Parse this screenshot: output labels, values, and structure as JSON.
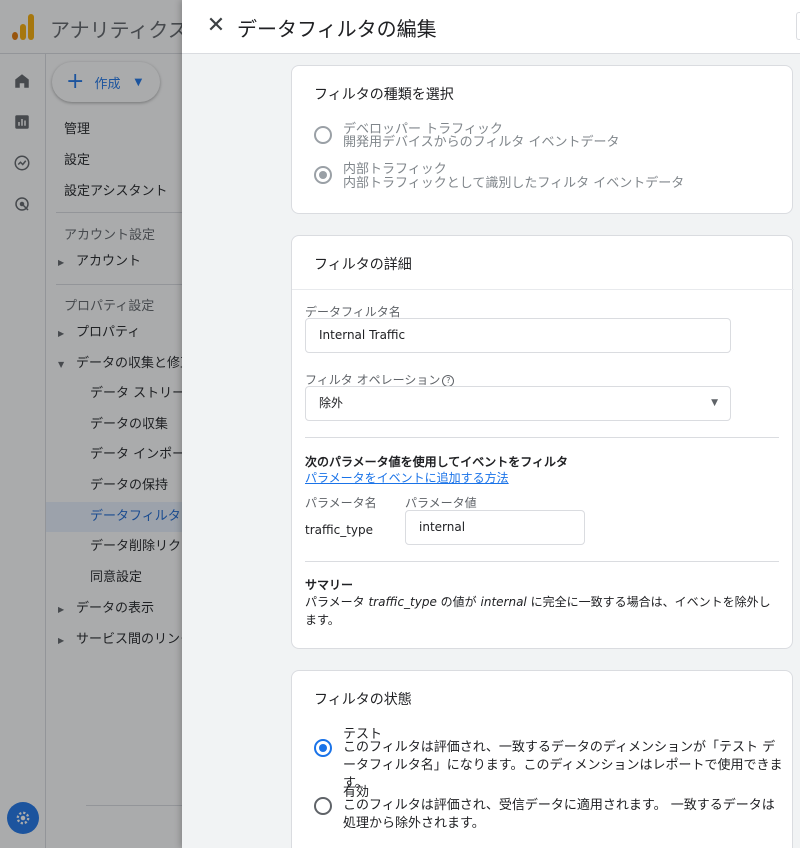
{
  "app": {
    "title": "アナリティクス",
    "create_label": "作成"
  },
  "nav": {
    "items": [
      {
        "label": "管理"
      },
      {
        "label": "設定"
      },
      {
        "label": "設定アシスタント"
      }
    ],
    "account_section": "アカウント設定",
    "account_item": "アカウント",
    "property_section": "プロパティ設定",
    "property_item": "プロパティ",
    "data_collection": "データの収集と修正",
    "sub_items": [
      {
        "label": "データ ストリーム"
      },
      {
        "label": "データの収集"
      },
      {
        "label": "データ インポート"
      },
      {
        "label": "データの保持"
      },
      {
        "label": "データフィルタ"
      },
      {
        "label": "データ削除リクエスト"
      },
      {
        "label": "同意設定"
      }
    ],
    "data_display": "データの表示",
    "service_links": "サービス間のリンク"
  },
  "panel": {
    "title": "データフィルタの編集",
    "type_card": {
      "title": "フィルタの種類を選択",
      "options": [
        {
          "label": "デベロッパー トラフィック",
          "desc": "開発用デバイスからのフィルタ イベントデータ",
          "checked": false
        },
        {
          "label": "内部トラフィック",
          "desc": "内部トラフィックとして識別したフィルタ イベントデータ",
          "checked": true
        }
      ]
    },
    "details_card": {
      "title": "フィルタの詳細",
      "name_label": "データフィルタ名",
      "name_value": "Internal Traffic",
      "operation_label": "フィルタ オペレーション",
      "operation_value": "除外",
      "param_heading": "次のパラメータ値を使用してイベントをフィルタ",
      "param_link": "パラメータをイベントに追加する方法",
      "param_name_header": "パラメータ名",
      "param_value_header": "パラメータ値",
      "param_name": "traffic_type",
      "param_value": "internal",
      "summary_title": "サマリー",
      "summary_pre": "パラメータ ",
      "summary_param": "traffic_type",
      "summary_mid": " の値が ",
      "summary_value": "internal",
      "summary_post": " に完全に一致する場合は、イベントを除外します。"
    },
    "state_card": {
      "title": "フィルタの状態",
      "options": [
        {
          "label": "テスト",
          "desc": "このフィルタは評価され、一致するデータのディメンションが「テスト データフィルタ名」になります。このディメンションはレポートで使用できます。",
          "checked": true
        },
        {
          "label": "有効",
          "desc": "このフィルタは評価され、受信データに適用されます。 一致するデータは処理から除外されます。",
          "checked": false
        }
      ]
    }
  },
  "colors": {
    "accent": "#1a73e8",
    "panel_bg": "#f1f3f4"
  }
}
